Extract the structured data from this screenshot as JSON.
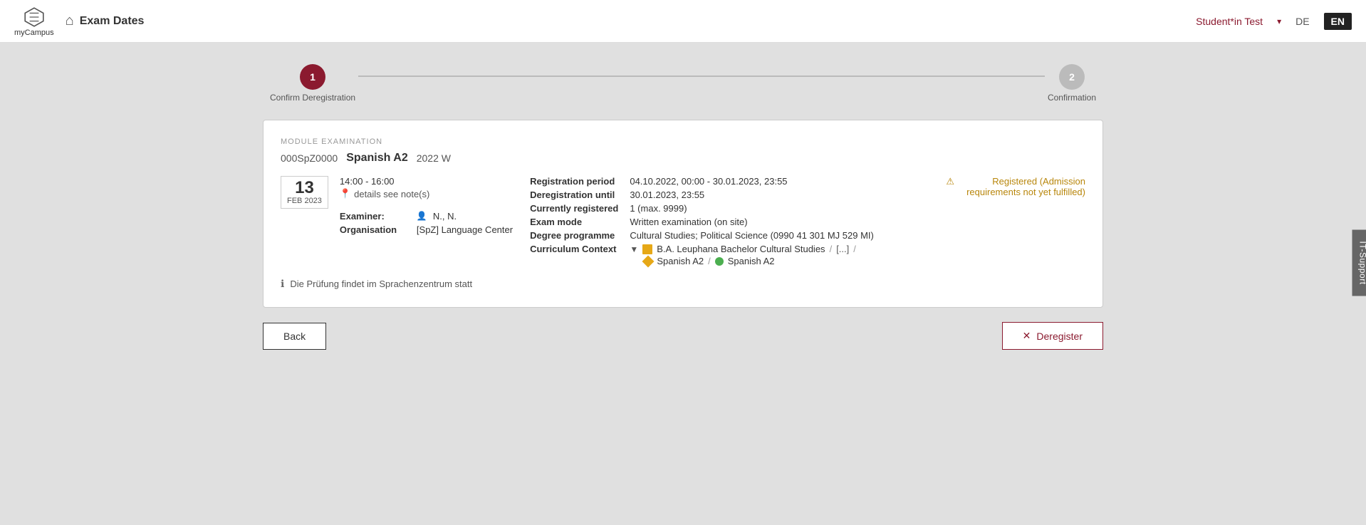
{
  "header": {
    "logo_text": "myCampus",
    "page_title": "Exam Dates",
    "user_name": "Student*in Test",
    "lang_de": "DE",
    "lang_en": "EN"
  },
  "stepper": {
    "step1_number": "1",
    "step1_label": "Confirm Deregistration",
    "step2_number": "2",
    "step2_label": "Confirmation"
  },
  "exam": {
    "section_label": "MODULE EXAMINATION",
    "code": "000SpZ0000",
    "name": "Spanish A2",
    "year": "2022 W",
    "date_day": "13",
    "date_month": "FEB 2023",
    "time": "14:00 - 16:00",
    "place": "details see note(s)",
    "examiner_label": "Examiner:",
    "examiner_value": "N., N.",
    "organisation_label": "Organisation",
    "organisation_value": "[SpZ] Language Center",
    "registration_period_label": "Registration period",
    "registration_period_value": "04.10.2022, 00:00 - 30.01.2023, 23:55",
    "deregistration_label": "Deregistration until",
    "deregistration_value": "30.01.2023, 23:55",
    "currently_registered_label": "Currently registered",
    "currently_registered_value": "1 (max. 9999)",
    "exam_mode_label": "Exam mode",
    "exam_mode_value": "Written examination (on site)",
    "degree_programme_label": "Degree programme",
    "degree_programme_value": "Cultural Studies; Political Science (0990 41 301 MJ 529 MI)",
    "curriculum_context_label": "Curriculum Context",
    "curriculum_path": "B.A. Leuphana Bachelor Cultural Studies",
    "curriculum_ellipsis": "[...]",
    "curriculum_item1": "Spanish A2",
    "curriculum_item2": "Spanish A2",
    "status_text": "Registered (Admission requirements not yet fulfilled)",
    "note_text": "Die Prüfung findet im Sprachenzentrum statt"
  },
  "buttons": {
    "back_label": "Back",
    "deregister_label": "Deregister"
  },
  "it_support": {
    "label": "IT-Support"
  }
}
